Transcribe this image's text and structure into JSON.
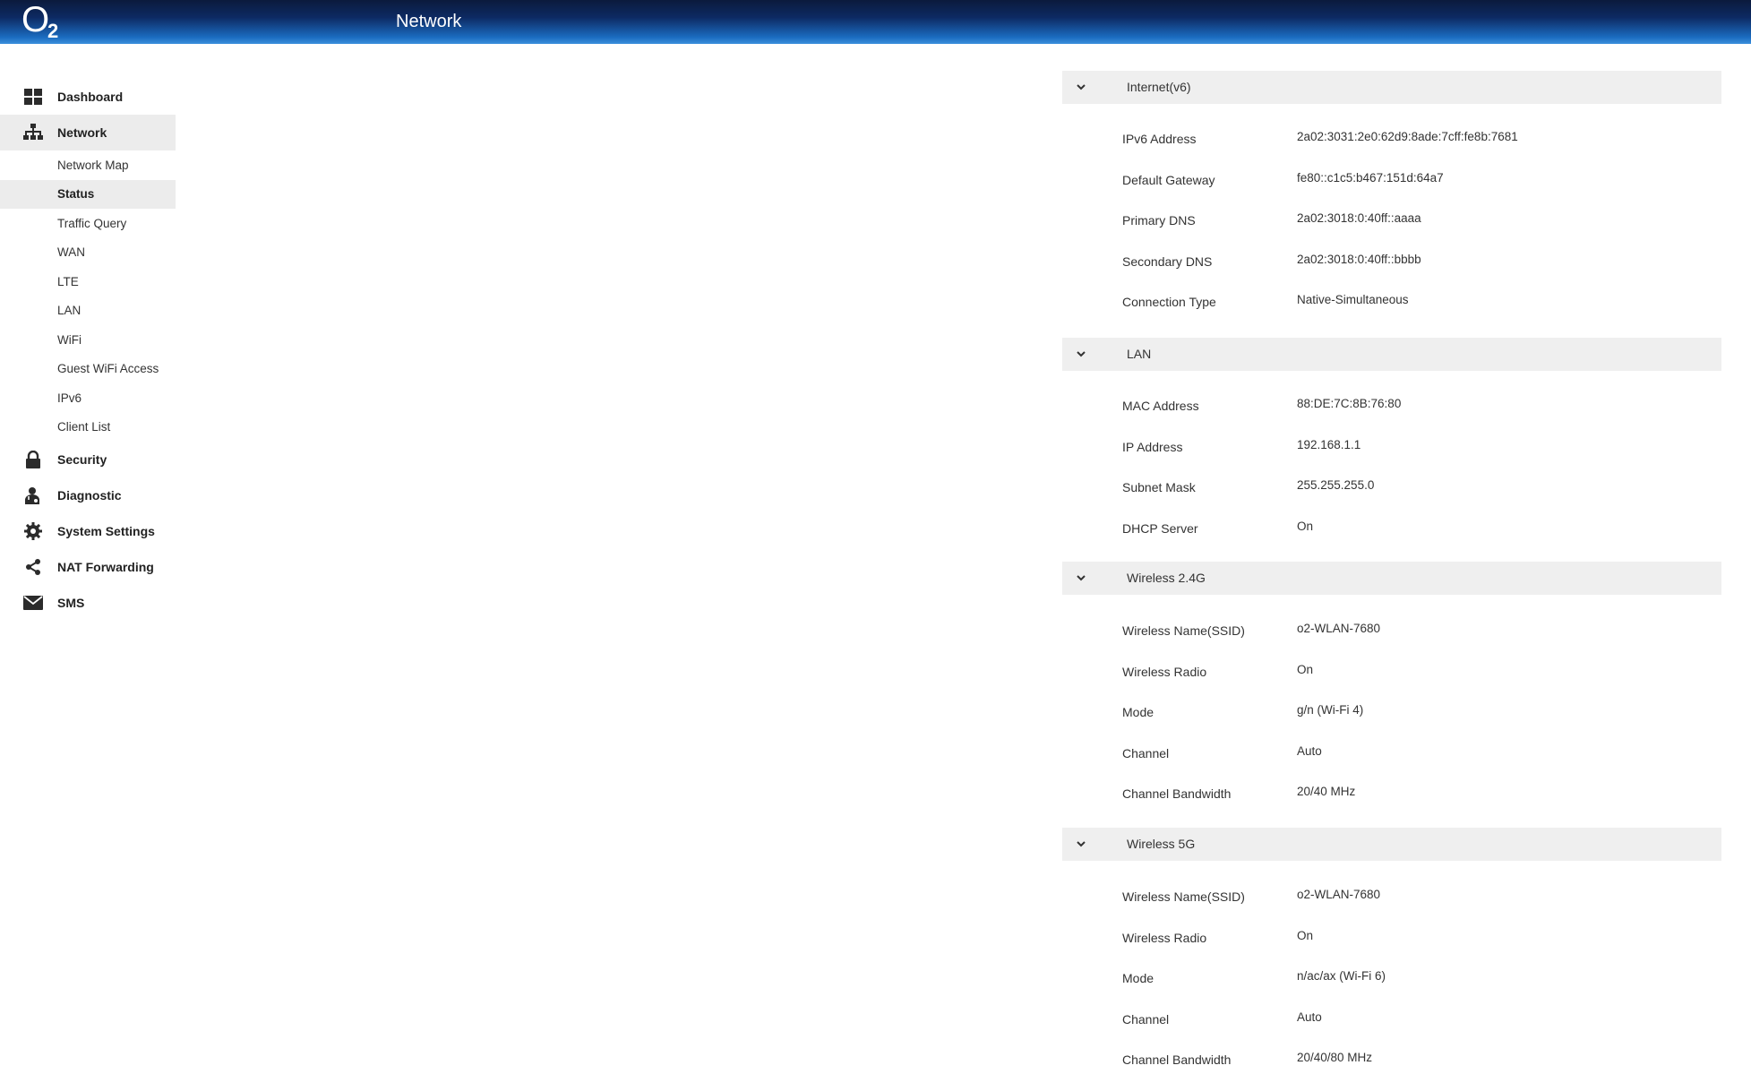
{
  "header": {
    "logo_main": "O",
    "logo_sub": "2",
    "title": "Network"
  },
  "sidebar": {
    "items": [
      {
        "label": "Dashboard",
        "icon": "dashboard-icon"
      },
      {
        "label": "Network",
        "icon": "network-icon",
        "active": true,
        "children": [
          {
            "label": "Network Map"
          },
          {
            "label": "Status",
            "active": true
          },
          {
            "label": "Traffic Query"
          },
          {
            "label": "WAN"
          },
          {
            "label": "LTE"
          },
          {
            "label": "LAN"
          },
          {
            "label": "WiFi"
          },
          {
            "label": "Guest WiFi Access"
          },
          {
            "label": "IPv6"
          },
          {
            "label": "Client List"
          }
        ]
      },
      {
        "label": "Security",
        "icon": "lock-icon"
      },
      {
        "label": "Diagnostic",
        "icon": "diagnostic-icon"
      },
      {
        "label": "System Settings",
        "icon": "gear-icon"
      },
      {
        "label": "NAT Forwarding",
        "icon": "share-icon"
      },
      {
        "label": "SMS",
        "icon": "envelope-icon"
      }
    ]
  },
  "sections": [
    {
      "title": "Internet(v6)",
      "rows": [
        {
          "label": "IPv6 Address",
          "value": "2a02:3031:2e0:62d9:8ade:7cff:fe8b:7681"
        },
        {
          "label": "Default Gateway",
          "value": "fe80::c1c5:b467:151d:64a7"
        },
        {
          "label": "Primary DNS",
          "value": "2a02:3018:0:40ff::aaaa"
        },
        {
          "label": "Secondary DNS",
          "value": "2a02:3018:0:40ff::bbbb"
        },
        {
          "label": "Connection Type",
          "value": "Native-Simultaneous"
        }
      ]
    },
    {
      "title": "LAN",
      "rows": [
        {
          "label": "MAC Address",
          "value": "88:DE:7C:8B:76:80"
        },
        {
          "label": "IP Address",
          "value": "192.168.1.1"
        },
        {
          "label": "Subnet Mask",
          "value": "255.255.255.0"
        },
        {
          "label": "DHCP Server",
          "value": "On"
        }
      ]
    },
    {
      "title": "Wireless 2.4G",
      "rows": [
        {
          "label": "Wireless Name(SSID)",
          "value": "o2-WLAN-7680"
        },
        {
          "label": "Wireless Radio",
          "value": "On"
        },
        {
          "label": "Mode",
          "value": "g/n (Wi-Fi 4)"
        },
        {
          "label": "Channel",
          "value": "Auto"
        },
        {
          "label": "Channel Bandwidth",
          "value": "20/40 MHz"
        }
      ]
    },
    {
      "title": "Wireless 5G",
      "rows": [
        {
          "label": "Wireless Name(SSID)",
          "value": "o2-WLAN-7680"
        },
        {
          "label": "Wireless Radio",
          "value": "On"
        },
        {
          "label": "Mode",
          "value": "n/ac/ax (Wi-Fi 6)"
        },
        {
          "label": "Channel",
          "value": "Auto"
        },
        {
          "label": "Channel Bandwidth",
          "value": "20/40/80 MHz"
        }
      ]
    }
  ]
}
